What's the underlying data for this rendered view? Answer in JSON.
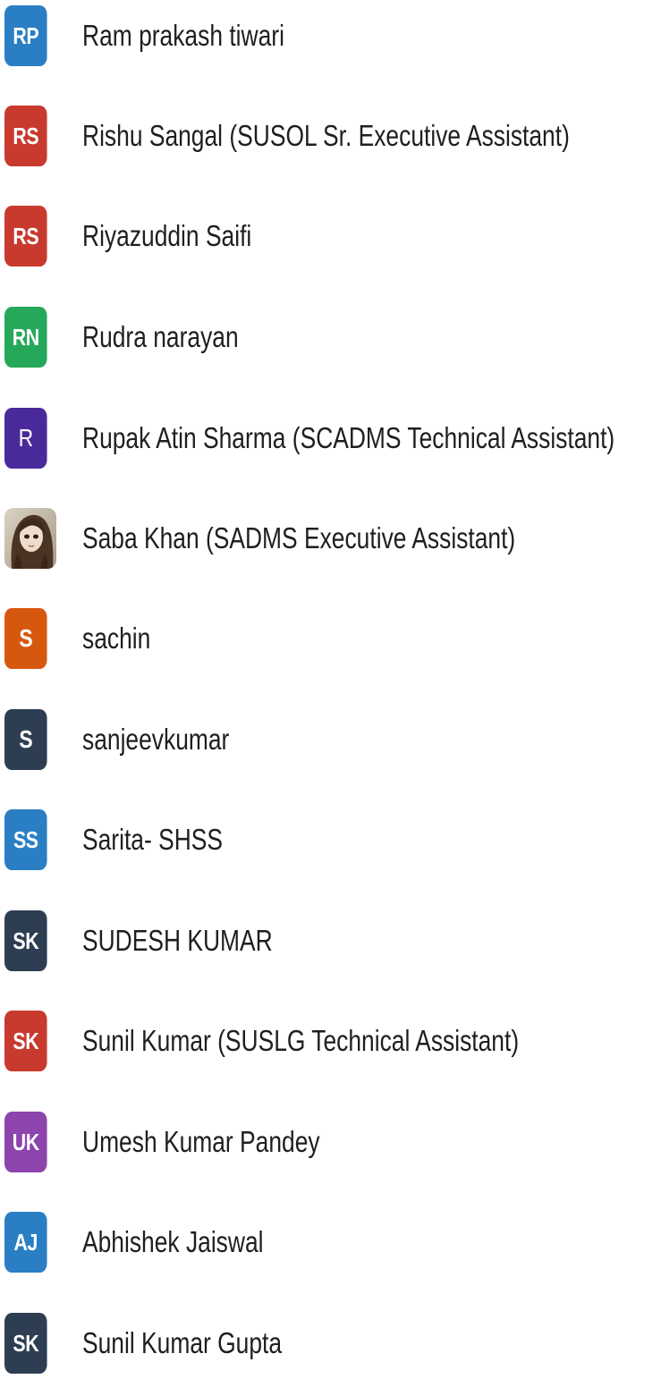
{
  "contacts": [
    {
      "initials": "RP",
      "name": "Ram prakash tiwari",
      "color": "#2a7fc4"
    },
    {
      "initials": "RS",
      "name": "Rishu Sangal (SUSOL Sr. Executive Assistant)",
      "color": "#c83a2e"
    },
    {
      "initials": "RS",
      "name": "Riyazuddin Saifi",
      "color": "#c83a2e"
    },
    {
      "initials": "RN",
      "name": "Rudra narayan",
      "color": "#25a85a"
    },
    {
      "initials": "R",
      "name": "Rupak Atin Sharma (SCADMS Technical Assistant)",
      "color": "#4a2a9a"
    },
    {
      "initials": "",
      "name": "Saba Khan (SADMS Executive Assistant)",
      "color": "#8a7a6a",
      "avatar_type": "photo"
    },
    {
      "initials": "S",
      "name": "sachin",
      "color": "#d6580f"
    },
    {
      "initials": "S",
      "name": "sanjeevkumar",
      "color": "#2d3e52"
    },
    {
      "initials": "SS",
      "name": "Sarita- SHSS",
      "color": "#2a7fc4"
    },
    {
      "initials": "SK",
      "name": "SUDESH KUMAR",
      "color": "#2d3e52"
    },
    {
      "initials": "SK",
      "name": "Sunil Kumar (SUSLG Technical Assistant)",
      "color": "#c83a2e"
    },
    {
      "initials": "UK",
      "name": "Umesh Kumar Pandey",
      "color": "#8e44ad"
    },
    {
      "initials": "AJ",
      "name": "Abhishek Jaiswal",
      "color": "#2a7fc4"
    },
    {
      "initials": "SK",
      "name": "Sunil Kumar Gupta",
      "color": "#2d3e52"
    }
  ]
}
